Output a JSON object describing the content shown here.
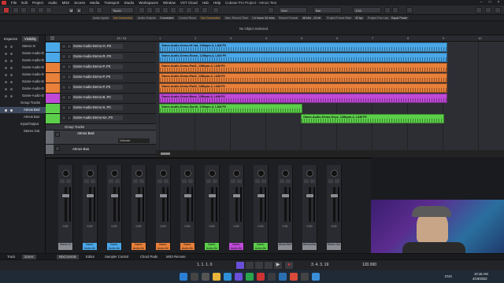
{
  "window": {
    "title": "Cubase Pro Project - Atmos Test",
    "menu": [
      "File",
      "Edit",
      "Project",
      "Audio",
      "MIDI",
      "Scores",
      "Media",
      "Transport",
      "Studio",
      "Workspaces",
      "Window",
      "VST Cloud",
      "Hub",
      "Help"
    ]
  },
  "toolbar": {
    "touch_mode": "Touch",
    "grid_type": "Grid",
    "quantize_label": "Bar",
    "quantize_value": "1/16"
  },
  "statusbar": {
    "items": [
      "Audio Inputs",
      "Not Connected",
      "Audio Outputs",
      "Connected",
      "Control Room",
      "Not Connected",
      "Max. Record Time",
      "1 h hours 34 mins",
      "Record Format",
      "48 kHz - 24 bit",
      "Project Frame Rate",
      "30 fps",
      "Project Pan Law",
      "Equal Power"
    ]
  },
  "infoline": {
    "text": "No Object Selected"
  },
  "inspector": {
    "tabs": [
      "Inspector",
      "Visibility"
    ],
    "items": [
      "Stereo In",
      "Game-Audio-D",
      "Game-Audio-D",
      "Game-Audio-D",
      "Game-Audio-D",
      "Game-Audio-D",
      "Game-Audio-D",
      "Game-Audio-D",
      "Group Tracks",
      "Atmos Bed",
      "Atmos Bus",
      "Input/Output",
      "Stereo Out"
    ]
  },
  "tracks": {
    "counter": "13 / 13",
    "items": [
      {
        "name": "Game-Audio-Demo-H..P0",
        "color": "#4aa8e8"
      },
      {
        "name": "Game-Audio-Demo-R..P0",
        "color": "#4aa8e8"
      },
      {
        "name": "Game-Audio-Demo-P..P0",
        "color": "#e8803a"
      },
      {
        "name": "Game-Audio-Demo-P..P0",
        "color": "#e8803a"
      },
      {
        "name": "Game-Audio-Demo-P..P0",
        "color": "#e8803a"
      },
      {
        "name": "Game-Audio-Demo-B..P0",
        "color": "#c04ad8"
      },
      {
        "name": "Game-Audio-Demo-S..P0",
        "color": "#5ccf4a"
      },
      {
        "name": "Game-Audio-Demo-Ke..P0",
        "color": "#5ccf4a"
      }
    ],
    "group_folder": "Group Tracks",
    "atmos_bed": "Atmos Bed",
    "atmos_bus": "Atmos Bus",
    "volume_label": "Volume"
  },
  "ruler": {
    "marks": [
      "1",
      "2",
      "3",
      "4",
      "5",
      "6",
      "7",
      "8",
      "9",
      "10"
    ]
  },
  "clips": [
    {
      "name": "Game-Audio-Demo-Hi hat, 128bpm-4, L&M P0",
      "color": "#4aa8e8"
    },
    {
      "name": "Game-Audio-Demo-Room, 128bpm-4, L&M P0",
      "color": "#4aa8e8"
    },
    {
      "name": "Game-Audio-Demo-Pad1, 128bpm-4, L&M P0",
      "color": "#e8803a"
    },
    {
      "name": "Game-Audio-Demo-Pad2, 128bpm-4, L&M P0",
      "color": "#e8803a"
    },
    {
      "name": "Game-Audio-Demo-Pad3, 128bpm-4, L&M P0",
      "color": "#e8803a"
    },
    {
      "name": "Game-Audio-Demo-Bass, 128bpm-4, L&M P0",
      "color": "#c04ad8"
    },
    {
      "name": "Game-Audio-Demo-Synth, 128bpm-4, L&M P0",
      "color": "#5ccf4a"
    },
    {
      "name": "Game-Audio-Demo-Keys, 128bpm-4, L&M P0",
      "color": "#5ccf4a"
    }
  ],
  "mixer": {
    "channels": [
      {
        "name": "Stereo In",
        "value": "0.00",
        "color": "#8a8c93"
      },
      {
        "name": "Game-Audio-De mo-Kick and Sna",
        "value": "0.00",
        "color": "#4aa8e8"
      },
      {
        "name": "Game-Audio-De mo-Room",
        "value": "0.00",
        "color": "#4aa8e8"
      },
      {
        "name": "Game-Audio-De mo-Pad1",
        "value": "0.00",
        "color": "#e8803a"
      },
      {
        "name": "Game-Audio-De mo-Pad2",
        "value": "0.00",
        "color": "#e8803a"
      },
      {
        "name": "Game-Audio-De mo-Pad3",
        "value": "0.00",
        "color": "#e8803a"
      },
      {
        "name": "Game-Audio-De mo-Synth",
        "value": "0.00",
        "color": "#5ccf4a"
      },
      {
        "name": "Game-Audio-De mo-Bass",
        "value": "0.00",
        "color": "#c04ad8"
      },
      {
        "name": "Game-Audio-De mo-Keys",
        "value": "0.00",
        "color": "#5ccf4a"
      },
      {
        "name": "Atmos Bed",
        "value": "0.00",
        "color": "#8a8c93"
      },
      {
        "name": "Atmos Bus",
        "value": "0.00",
        "color": "#8a8c93"
      },
      {
        "name": "Stereo Out",
        "value": "0.00",
        "color": "#8a8c93"
      }
    ]
  },
  "bottom_tabs": [
    "Track",
    "Zones",
    "MixConsole",
    "Editor",
    "Sampler Control",
    "Chord Pads",
    "MIDI Remote"
  ],
  "transport": {
    "position": "1. 1. 1. 0",
    "tempo": "120.000",
    "locator": "3. 4. 3. 19"
  },
  "taskbar": {
    "time": "10:15 AM",
    "date": "4/19/2022",
    "lang": "ENG"
  }
}
